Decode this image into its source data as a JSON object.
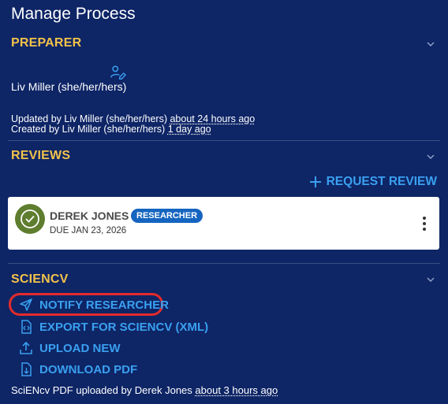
{
  "page": {
    "title": "Manage Process"
  },
  "preparer": {
    "heading": "PREPARER",
    "name": "Liv Miller (she/her/hers)",
    "updated_prefix": "Updated by Liv Miller (she/her/hers)",
    "updated_time": "about 24 hours ago",
    "created_prefix": "Created by Liv Miller (she/her/hers)",
    "created_time": "1 day ago"
  },
  "reviews": {
    "heading": "REVIEWS",
    "request_label": "REQUEST REVIEW",
    "items": [
      {
        "name": "DEREK JONES",
        "role": "RESEARCHER",
        "due": "DUE JAN 23, 2026",
        "status_color": "#5e7d2e"
      }
    ]
  },
  "sciencv": {
    "heading": "SCIENCV",
    "actions": [
      {
        "label": "NOTIFY RESEARCHER",
        "icon": "send-icon"
      },
      {
        "label": "EXPORT FOR SCIENCV (XML)",
        "icon": "code-file-icon"
      },
      {
        "label": "UPLOAD NEW",
        "icon": "upload-icon"
      },
      {
        "label": "DOWNLOAD PDF",
        "icon": "download-file-icon"
      }
    ],
    "upload_prefix": "SciENcv PDF uploaded by Derek Jones",
    "upload_time": "about 3 hours ago"
  },
  "colors": {
    "background": "#0e2566",
    "heading": "#f2c24a",
    "link": "#3aa0f0",
    "highlight": "#e32b2b"
  }
}
